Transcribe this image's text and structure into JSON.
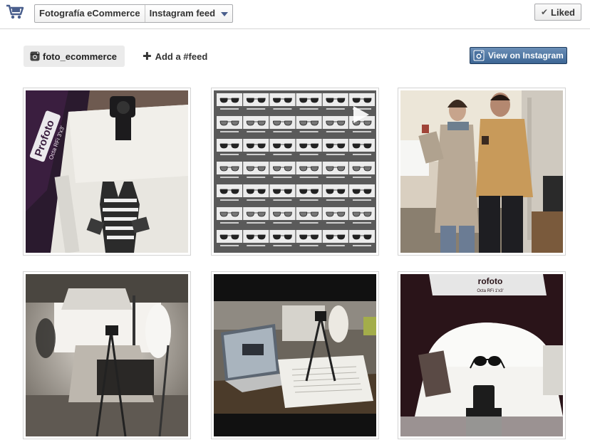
{
  "header": {
    "breadcrumb_page": "Fotografía eCommerce",
    "breadcrumb_tab": "Instagram feed",
    "liked_label": "Liked"
  },
  "actions": {
    "account_label": "foto_ecommerce",
    "add_feed_label": "Add a #feed",
    "view_instagram_label": "View on Instagram"
  },
  "colors": {
    "view_button": "#4a72a0",
    "account_pill": "#ebebeb"
  },
  "photos": [
    {
      "name": "photo-profoto-studio-garment",
      "overlay_text": "Profoto",
      "overlay_subtext": "Octa RFi 3'x3'"
    },
    {
      "name": "photo-sunglasses-contact-sheet",
      "type": "video"
    },
    {
      "name": "photo-two-people-holding-mugs"
    },
    {
      "name": "photo-studio-lights-setup"
    },
    {
      "name": "photo-laptop-tethered-shoot"
    },
    {
      "name": "photo-sunglasses-on-white-table",
      "overlay_text": "rofoto",
      "overlay_subtext": "Octa RFi 1'x3'"
    }
  ]
}
